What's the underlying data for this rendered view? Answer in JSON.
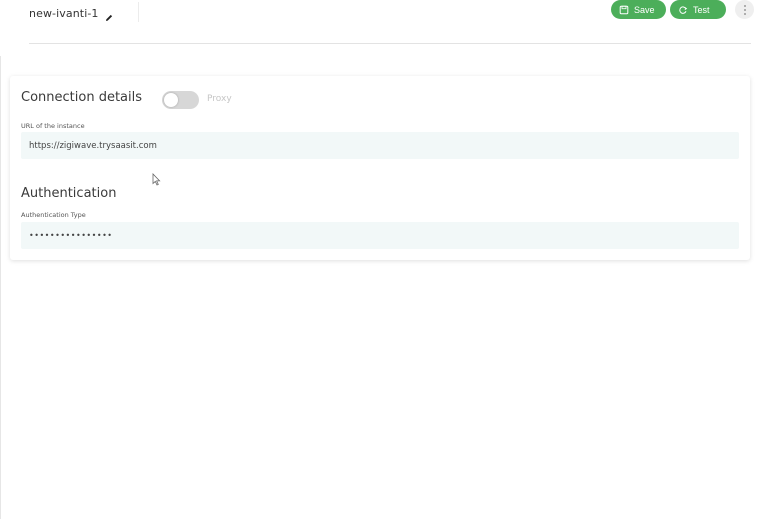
{
  "header": {
    "connection_name": "new-ivanti-1",
    "save_label": "Save",
    "test_label": "Test",
    "edit_icon": "pencil-icon",
    "more_icon": "vertical-dots-icon"
  },
  "connection": {
    "title": "Connection details",
    "proxy_label": "Proxy",
    "proxy_enabled": false,
    "url_label": "URL of the instance",
    "url_value": "https://zigiwave.trysaasit.com"
  },
  "authentication": {
    "title": "Authentication",
    "type_label": "Authentication Type",
    "type_value": "••••••••••••••••"
  },
  "colors": {
    "accent_green": "#4cae5a",
    "field_background": "#f2f8f8",
    "toggle_off": "#d7d7d7"
  }
}
